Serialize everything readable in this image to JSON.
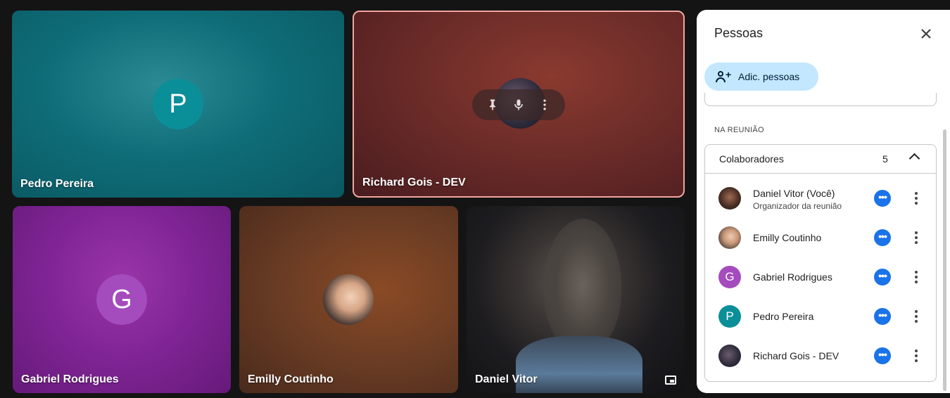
{
  "tiles": {
    "pedro": {
      "name": "Pedro Pereira",
      "initial": "P"
    },
    "richard": {
      "name": "Richard Gois - DEV",
      "pin_icon": "pin-icon",
      "mic_icon": "mic-icon",
      "more_icon": "more-vert-icon"
    },
    "gabriel": {
      "name": "Gabriel Rodrigues",
      "initial": "G"
    },
    "emilly": {
      "name": "Emilly Coutinho"
    },
    "daniel": {
      "name": "Daniel Vitor",
      "pip_icon": "picture-in-picture-icon"
    }
  },
  "panel": {
    "title": "Pessoas",
    "close_icon": "close-icon",
    "add_button": "Adic. pessoas",
    "section_label": "NA REUNIÃO",
    "group": {
      "title": "Colaboradores",
      "count": "5",
      "participants": [
        {
          "name": "Daniel Vitor (Você)",
          "subtitle": "Organizador da reunião"
        },
        {
          "name": "Emilly Coutinho"
        },
        {
          "name": "Gabriel Rodrigues",
          "initial": "G"
        },
        {
          "name": "Pedro Pereira",
          "initial": "P"
        },
        {
          "name": "Richard Gois - DEV"
        }
      ]
    }
  },
  "colors": {
    "accent": "#1a73e8",
    "add_button_bg": "#c2e7ff",
    "pedro_avatar": "#0a8f99",
    "gabriel_avatar": "#a44bbd",
    "active_border": "#f2a59d"
  }
}
